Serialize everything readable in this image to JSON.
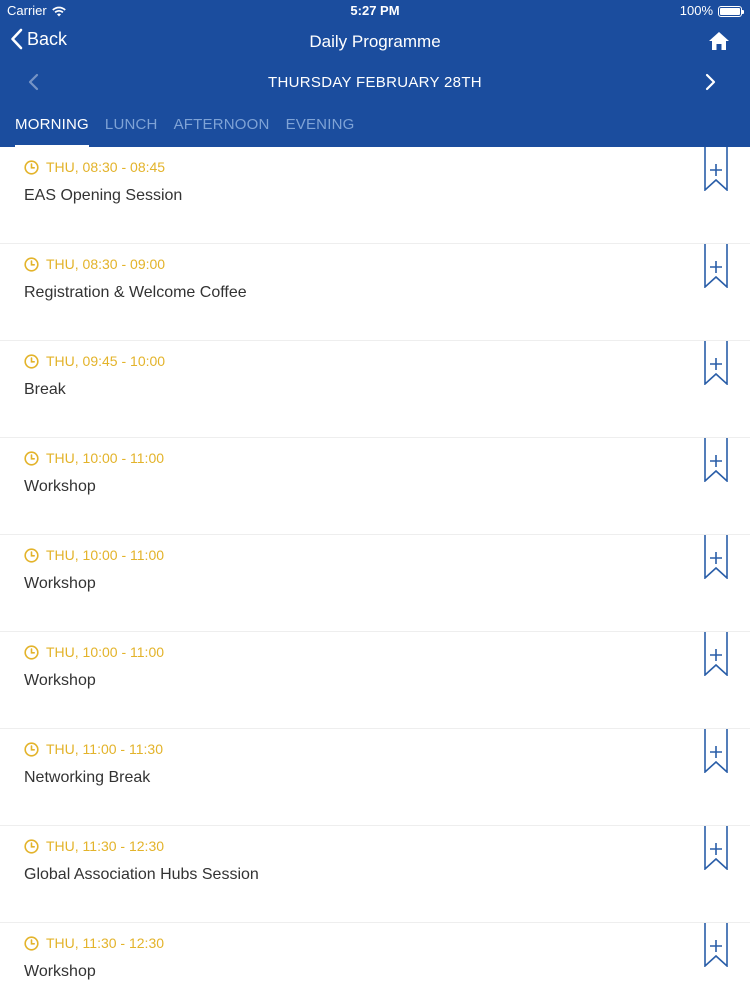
{
  "status": {
    "carrier": "Carrier",
    "time": "5:27 PM",
    "battery": "100%"
  },
  "nav": {
    "back_label": "Back",
    "title": "Daily Programme"
  },
  "day": {
    "title": "THURSDAY FEBRUARY 28TH"
  },
  "tabs": [
    {
      "label": "MORNING",
      "active": true
    },
    {
      "label": "LUNCH",
      "active": false
    },
    {
      "label": "AFTERNOON",
      "active": false
    },
    {
      "label": "EVENING",
      "active": false
    }
  ],
  "colors": {
    "header": "#1b4d9e",
    "time": "#e3b32a",
    "bookmark": "#2a5ea8"
  },
  "sessions": [
    {
      "time": "THU, 08:30 - 08:45",
      "title": "EAS Opening Session"
    },
    {
      "time": "THU, 08:30 - 09:00",
      "title": "Registration & Welcome Coffee"
    },
    {
      "time": "THU, 09:45 - 10:00",
      "title": "Break"
    },
    {
      "time": "THU, 10:00 - 11:00",
      "title": "Workshop"
    },
    {
      "time": "THU, 10:00 - 11:00",
      "title": "Workshop"
    },
    {
      "time": "THU, 10:00 - 11:00",
      "title": "Workshop"
    },
    {
      "time": "THU, 11:00 - 11:30",
      "title": "Networking Break"
    },
    {
      "time": "THU, 11:30 - 12:30",
      "title": "Global Association Hubs Session"
    },
    {
      "time": "THU, 11:30 - 12:30",
      "title": "Workshop"
    }
  ]
}
